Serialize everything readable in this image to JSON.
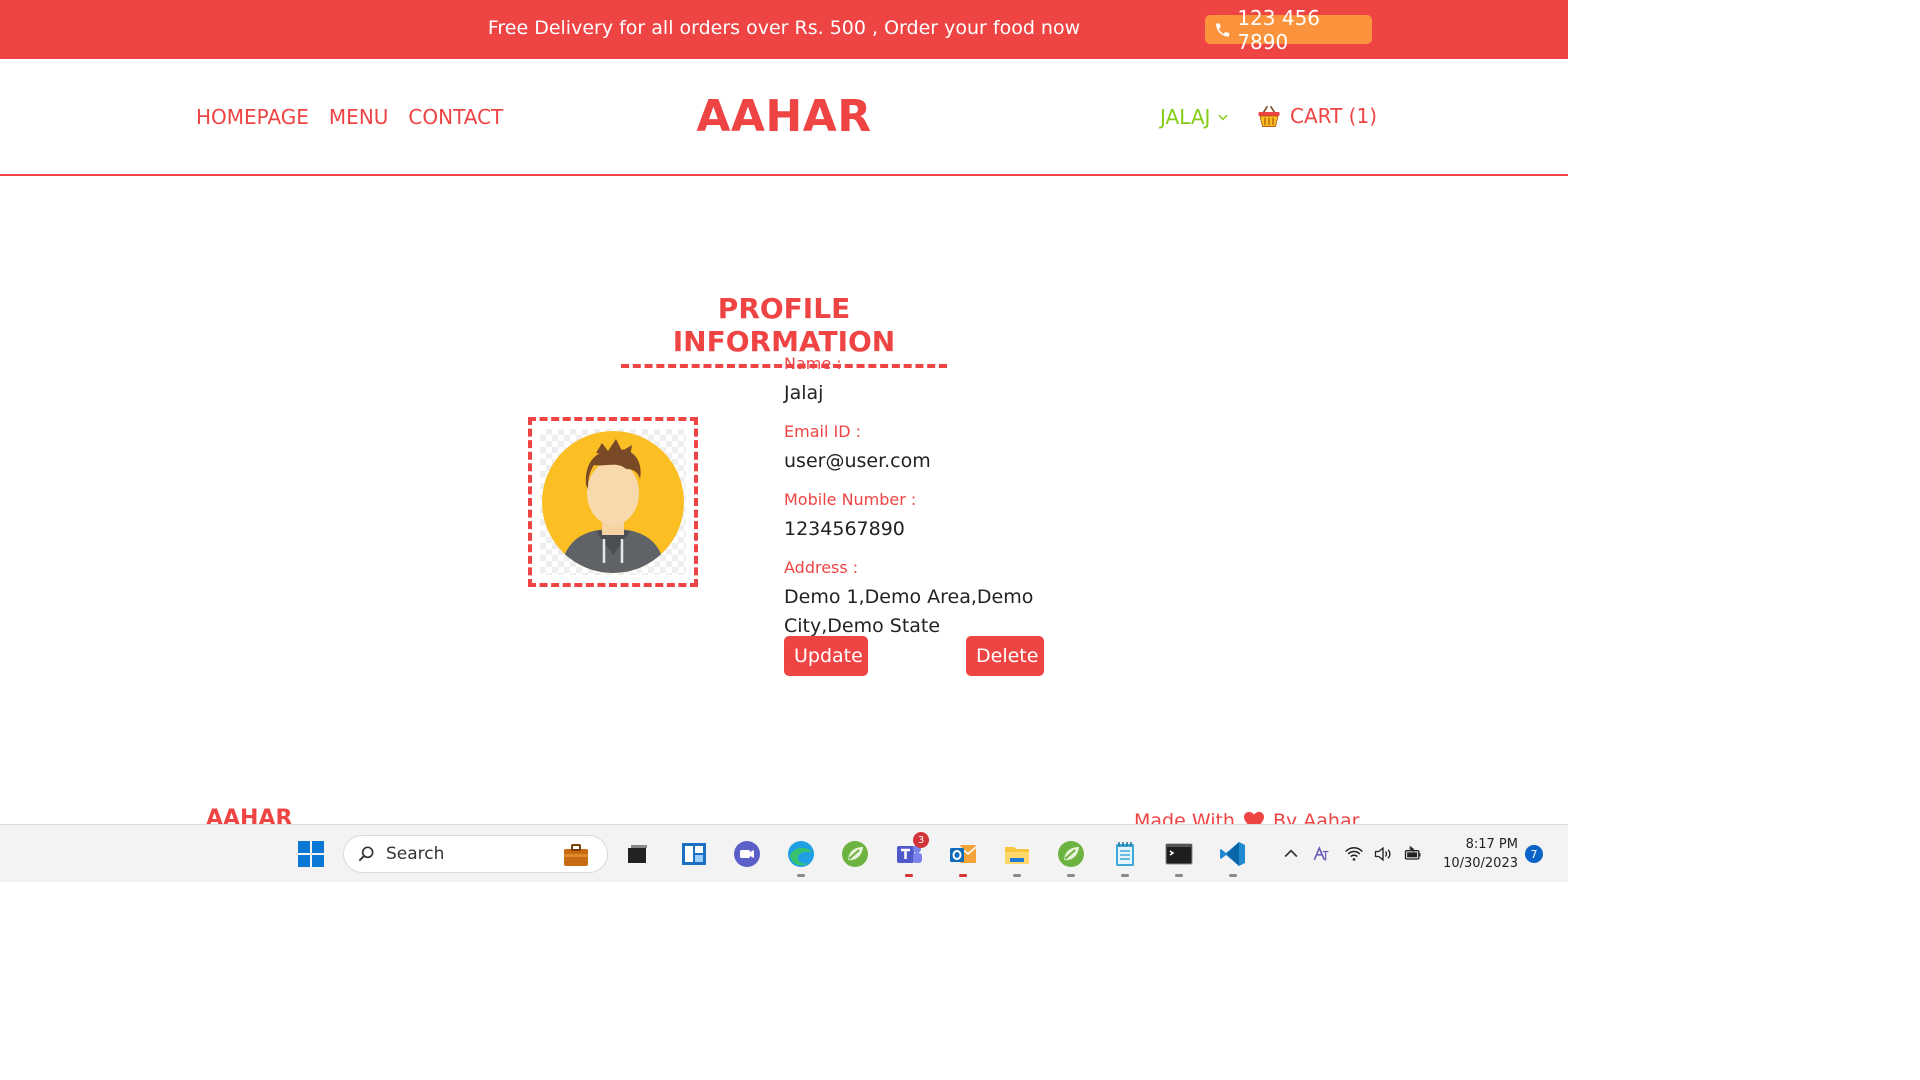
{
  "promo": {
    "text": "Free Delivery for all orders over Rs. 500 , Order your food now",
    "phone": "123 456 7890"
  },
  "nav": {
    "links": [
      "HOMEPAGE",
      "MENU",
      "CONTACT"
    ],
    "brand": "AAHAR",
    "user": "JALAJ",
    "cart": "CART (1)"
  },
  "profile": {
    "title": "PROFILE INFORMATION",
    "fields": [
      {
        "label": "Name :",
        "value": "Jalaj"
      },
      {
        "label": "Email ID :",
        "value": "user@user.com"
      },
      {
        "label": "Mobile Number :",
        "value": "1234567890"
      },
      {
        "label": "Address :",
        "value": "Demo 1,Demo Area,Demo City,Demo State"
      }
    ],
    "update_label": "Update",
    "delete_label": "Delete"
  },
  "footer": {
    "brand": "AAHAR",
    "made_with_prefix": "Made With",
    "made_with_suffix": "By Aahar"
  },
  "taskbar": {
    "search_placeholder": "Search",
    "teams_badge": "3",
    "time": "8:17 PM",
    "date": "10/30/2023",
    "notifications": "7"
  },
  "colors": {
    "primary": "#ef4444",
    "accent_orange": "#fb923c",
    "user_green": "#84cc16"
  }
}
